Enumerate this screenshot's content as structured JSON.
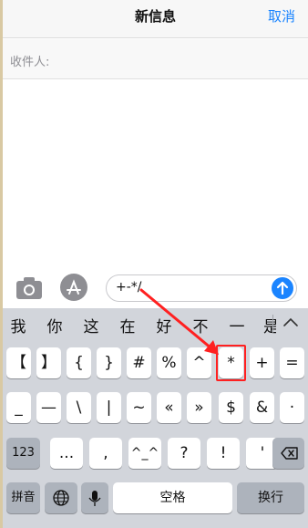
{
  "header": {
    "title": "新信息",
    "cancel": "取消"
  },
  "recipient": {
    "label": "收件人:"
  },
  "compose": {
    "text": "+-*/"
  },
  "candidates": [
    "我",
    "你",
    "这",
    "在",
    "好",
    "不",
    "一",
    "是"
  ],
  "keyboard": {
    "row1": [
      "【",
      "】",
      "{",
      "}",
      "#",
      "%",
      "^",
      "*",
      "+",
      "="
    ],
    "row2": [
      "_",
      "—",
      "\\",
      "|",
      "~",
      "«",
      "»",
      "$",
      "&",
      "·"
    ],
    "row3": {
      "mode": "123",
      "keys": [
        "...",
        ",",
        "^_^",
        "?",
        "!",
        "'"
      ]
    },
    "row4": {
      "pinyin": "拼音",
      "space": "空格",
      "return": "换行"
    }
  },
  "colors": {
    "accent": "#1a84ff",
    "highlight": "#ff2020"
  },
  "icons": [
    "camera-icon",
    "app-store-icon",
    "send-arrow-icon",
    "chevron-up-icon",
    "delete-icon",
    "globe-icon",
    "microphone-icon"
  ]
}
